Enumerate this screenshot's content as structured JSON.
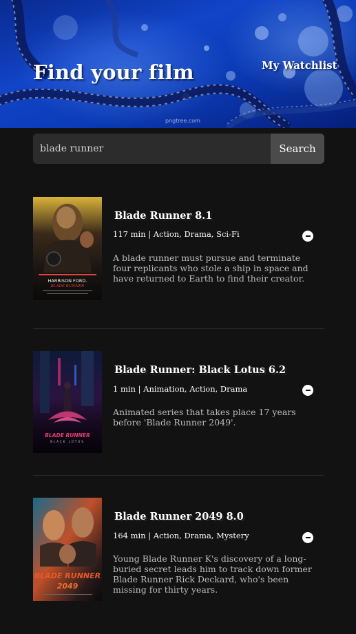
{
  "header": {
    "title": "Find your film",
    "watchlist_link": "My Watchlist"
  },
  "search": {
    "value": "blade runner",
    "button_label": "Search"
  },
  "results": [
    {
      "title": "Blade Runner 8.1",
      "meta": "117 min | Action, Drama, Sci-Fi",
      "plot": "A blade runner must pursue and terminate four replicants who stole a ship in space and have returned to Earth to find their creator.",
      "poster_caption": "HARRISON FORD.",
      "poster_logo": "BLADE RUNNER"
    },
    {
      "title": "Blade Runner: Black Lotus 6.2",
      "meta": "1 min | Animation, Action, Drama",
      "plot": "Animated series that takes place 17 years before 'Blade Runner 2049'.",
      "poster_logo": "BLADE RUNNER",
      "poster_subtitle": "BLACK LOTUS"
    },
    {
      "title": "Blade Runner 2049 8.0",
      "meta": "164 min | Action, Drama, Mystery",
      "plot": "Young Blade Runner K's discovery of a long-buried secret leads him to track down former Blade Runner Rick Deckard, who's been missing for thirty years.",
      "poster_logo": "BLADE RUNNER",
      "poster_year": "2049"
    }
  ]
}
